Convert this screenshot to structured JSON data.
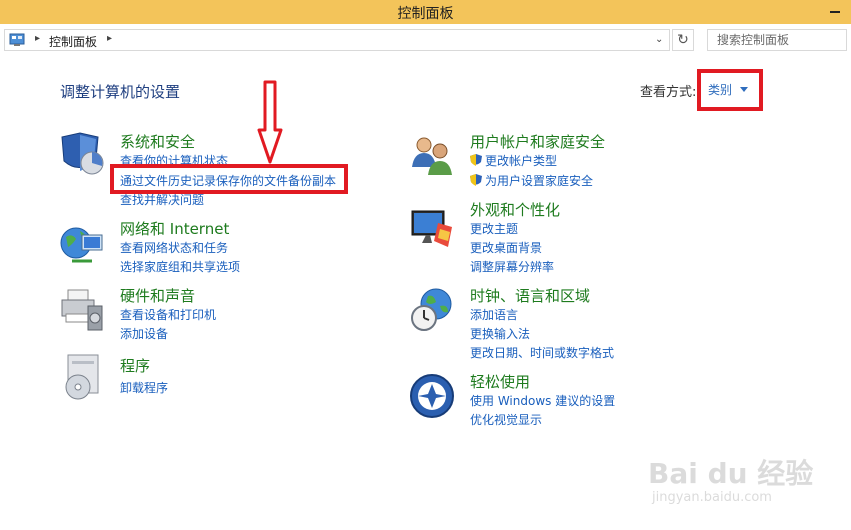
{
  "window": {
    "title": "控制面板"
  },
  "address": {
    "crumb": "控制面板",
    "search_placeholder": "搜索控制面板"
  },
  "header": {
    "page_title": "调整计算机的设置",
    "viewby_label": "查看方式:",
    "viewby_value": "类别"
  },
  "categories_left": [
    {
      "title": "系统和安全",
      "links": [
        "查看你的计算机状态",
        "通过文件历史记录保存你的文件备份副本",
        "查找并解决问题"
      ]
    },
    {
      "title": "网络和 Internet",
      "links": [
        "查看网络状态和任务",
        "选择家庭组和共享选项"
      ]
    },
    {
      "title": "硬件和声音",
      "links": [
        "查看设备和打印机",
        "添加设备"
      ]
    },
    {
      "title": "程序",
      "links": [
        "卸载程序"
      ]
    }
  ],
  "categories_right": [
    {
      "title": "用户帐户和家庭安全",
      "links": [
        "更改帐户类型",
        "为用户设置家庭安全"
      ]
    },
    {
      "title": "外观和个性化",
      "links": [
        "更改主题",
        "更改桌面背景",
        "调整屏幕分辨率"
      ]
    },
    {
      "title": "时钟、语言和区域",
      "links": [
        "添加语言",
        "更换输入法",
        "更改日期、时间或数字格式"
      ]
    },
    {
      "title": "轻松使用",
      "links": [
        "使用 Windows 建议的设置",
        "优化视觉显示"
      ]
    }
  ],
  "watermark": {
    "brand": "Bai du 经验",
    "url": "jingyan.baidu.com"
  },
  "colors": {
    "titlebar": "#f3c45a",
    "link": "#1a5fbd",
    "category": "#1e7b1e",
    "highlight": "#e11a22"
  },
  "icons": [
    "shield-pie-icon",
    "user-accounts-icon",
    "network-globe-icon",
    "appearance-monitor-icon",
    "printer-icon",
    "clock-globe-icon",
    "programs-icon",
    "ease-of-access-icon",
    "uac-shield-icon"
  ]
}
